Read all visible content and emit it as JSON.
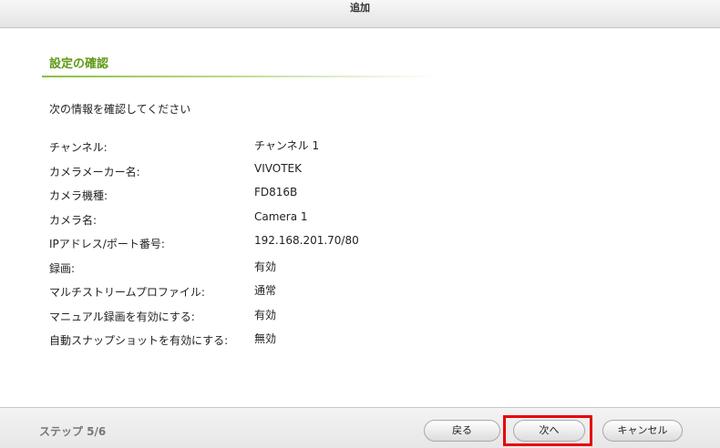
{
  "window": {
    "title": "追加"
  },
  "section": {
    "title": "設定の確認",
    "instruction": "次の情報を確認してください"
  },
  "settings": [
    {
      "label": "チャンネル:",
      "value": "チャンネル 1"
    },
    {
      "label": "カメラメーカー名:",
      "value": "VIVOTEK"
    },
    {
      "label": "カメラ機種:",
      "value": "FD816B"
    },
    {
      "label": "カメラ名:",
      "value": "Camera 1"
    },
    {
      "label": "IPアドレス/ポート番号:",
      "value": "192.168.201.70/80"
    },
    {
      "label": "録画:",
      "value": "有効"
    },
    {
      "label": "マルチストリームプロファイル:",
      "value": "通常"
    },
    {
      "label": "マニュアル録画を有効にする:",
      "value": "有効"
    },
    {
      "label": "自動スナップショットを有効にする:",
      "value": "無効"
    }
  ],
  "footer": {
    "step": "ステップ 5/6",
    "back_label": "戻る",
    "next_label": "次へ",
    "cancel_label": "キャンセル"
  },
  "colors": {
    "section_title": "#5e9a14",
    "highlight_border": "#e8000f"
  }
}
